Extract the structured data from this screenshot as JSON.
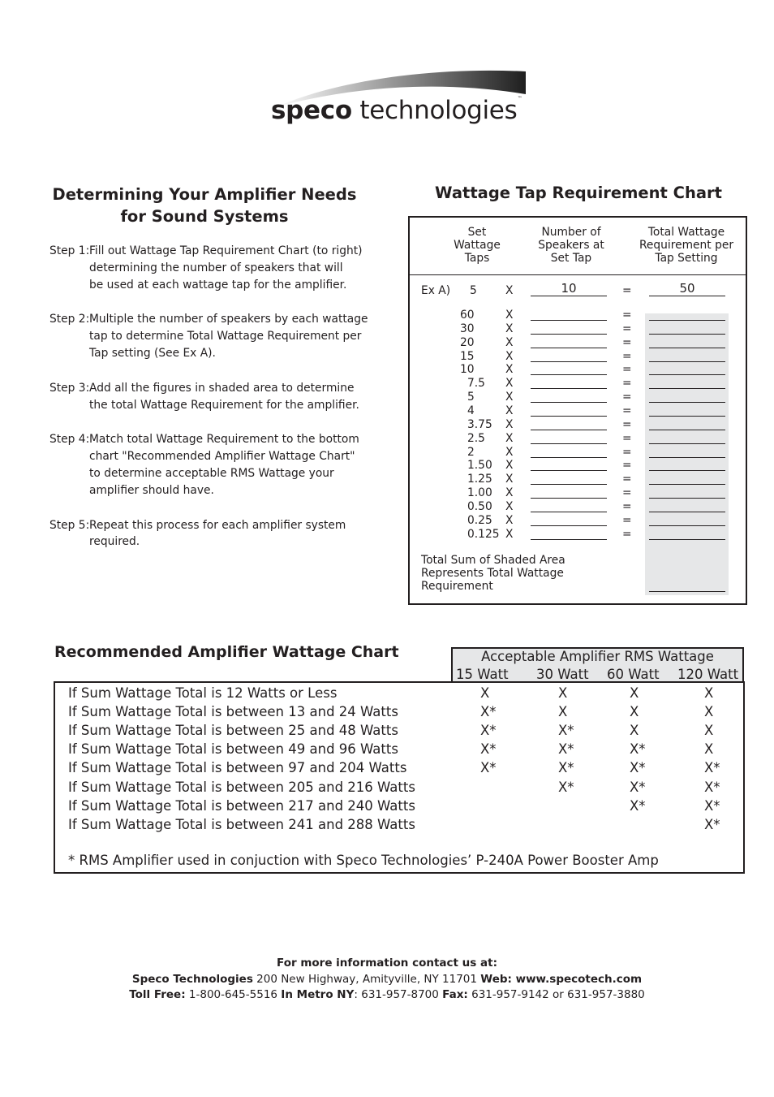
{
  "logo": {
    "brand_bold": "speco",
    "brand_light": " technologies",
    "trademark": "™"
  },
  "instructions": {
    "title_line1": "Determining Your Amplifier Needs",
    "title_line2": "for Sound Systems",
    "steps": [
      {
        "label": "Step 1:",
        "text": "Fill out Wattage Tap Requirement Chart (to right)\ndetermining the number of speakers that will\nbe used at each wattage tap for the amplifier."
      },
      {
        "label": "Step 2:",
        "text": "Multiple the number of speakers by each wattage\ntap to determine Total Wattage Requirement per\nTap setting (See Ex A)."
      },
      {
        "label": "Step 3:",
        "text": "Add all the figures in shaded area to determine\nthe total Wattage Requirement for the amplifier."
      },
      {
        "label": "Step 4:",
        "text": "Match total Wattage Requirement to the bottom\nchart \"Recommended Amplifier Wattage Chart\"\nto determine acceptable RMS Wattage your\namplifier should have."
      },
      {
        "label": "Step 5:",
        "text": "Repeat this process for each amplifier system\nrequired."
      }
    ]
  },
  "tap_chart": {
    "title": "Wattage Tap Requirement Chart",
    "headers": [
      "Set\nWattage\nTaps",
      "Number of\nSpeakers at\nSet Tap",
      "Total Wattage\nRequirement per\nTap Setting"
    ],
    "example": {
      "label": "Ex A)",
      "tap": "5",
      "times": "X",
      "speakers": "10",
      "equals": "=",
      "total": "50"
    },
    "taps": [
      "60",
      "30",
      "20",
      "15",
      "10",
      "7.5",
      "5",
      "4",
      "3.75",
      "2.5",
      "2",
      "1.50",
      "1.25",
      "1.00",
      "0.50",
      "0.25",
      "0.125"
    ],
    "times_symbol": "X",
    "equals_symbol": "=",
    "total_note": "Total Sum of Shaded Area\nRepresents Total Wattage\nRequirement"
  },
  "recommended_chart": {
    "title": "Recommended Amplifier Wattage Chart",
    "group_header": "Acceptable Amplifier RMS Wattage",
    "columns": [
      "15 Watt",
      "30 Watt",
      "60 Watt",
      "120 Watt"
    ],
    "rows": [
      {
        "condition": "If Sum Wattage Total is 12 Watts or Less",
        "marks": [
          "X",
          "X",
          "X",
          "X"
        ]
      },
      {
        "condition": "If Sum Wattage Total is between 13 and 24 Watts",
        "marks": [
          "X*",
          "X",
          "X",
          "X"
        ]
      },
      {
        "condition": "If Sum Wattage Total is between 25 and 48 Watts",
        "marks": [
          "X*",
          "X*",
          "X",
          "X"
        ]
      },
      {
        "condition": "If Sum Wattage Total is between 49 and 96 Watts",
        "marks": [
          "X*",
          "X*",
          "X*",
          "X"
        ]
      },
      {
        "condition": "If Sum Wattage Total is between 97 and 204 Watts",
        "marks": [
          "X*",
          "X*",
          "X*",
          "X*"
        ]
      },
      {
        "condition": "If Sum Wattage Total is between 205 and 216 Watts",
        "marks": [
          "",
          "X*",
          "X*",
          "X*"
        ]
      },
      {
        "condition": "If Sum Wattage Total is between 217 and 240 Watts",
        "marks": [
          "",
          "",
          "X*",
          "X*"
        ]
      },
      {
        "condition": "If Sum Wattage Total is between 241 and 288 Watts",
        "marks": [
          "",
          "",
          "",
          "X*"
        ]
      }
    ],
    "footnote": "* RMS Amplifier used in conjuction with Speco Technologies’ P-240A Power Booster Amp"
  },
  "footer": {
    "line1": "For more information contact us at:",
    "company": "Speco Technologies",
    "address": " 200 New Highway, Amityville, NY 11701 ",
    "web_label": "Web: www.specotech.com",
    "tollfree_label": "Toll Free:",
    "tollfree": " 1-800-645-5516 ",
    "metro_label": "In Metro NY",
    "metro": ": 631-957-8700 ",
    "fax_label": "Fax:",
    "fax": " 631-957-9142 or 631-957-3880"
  }
}
